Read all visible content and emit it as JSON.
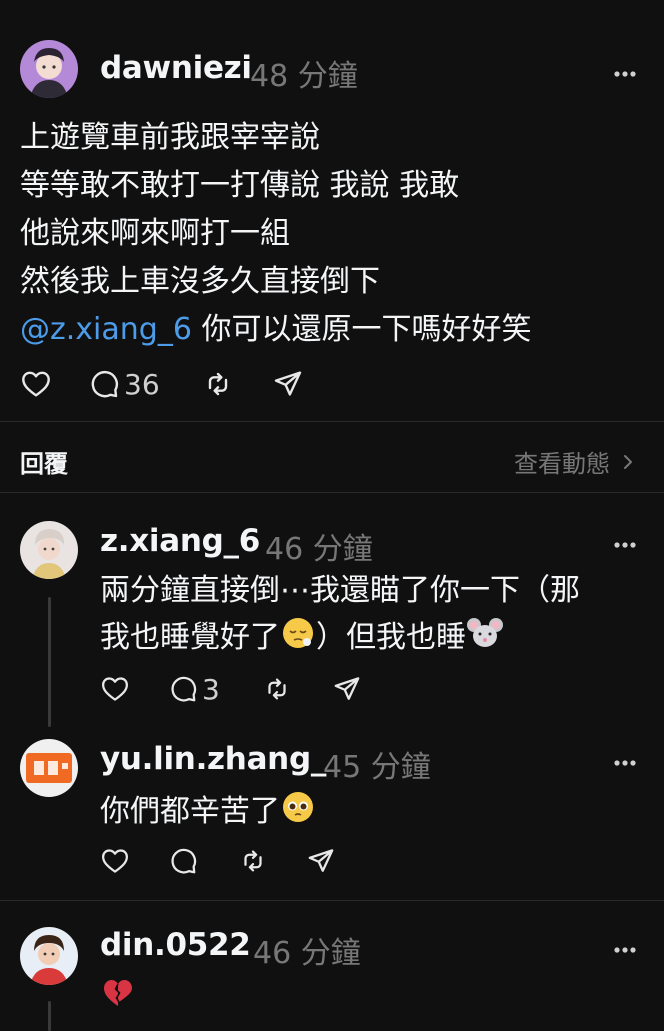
{
  "main_post": {
    "username": "dawniezi",
    "time": "48 分鐘",
    "lines": [
      "上遊覽車前我跟宰宰說",
      "等等敢不敢打一打傳說 我說 我敢",
      "他說來啊來啊打一組",
      "然後我上車沒多久直接倒下"
    ],
    "mention": "@z.xiang_6",
    "last_line_rest": " 你可以還原一下嗎好好笑",
    "reply_count": "36"
  },
  "replies_section": {
    "label": "回覆",
    "view_activity": "查看動態"
  },
  "replies": [
    {
      "username": "z.xiang_6",
      "time": "46 分鐘",
      "line1": "兩分鐘直接倒⋯我還瞄了你一下（那",
      "line2_before": "我也睡覺好了",
      "line2_mid": "）但我也睡",
      "reply_count": "3"
    },
    {
      "username": "yu.lin.zhang_",
      "time": "45 分鐘",
      "line1": "你們都辛苦了"
    },
    {
      "username": "din.0522",
      "time": "46 分鐘"
    }
  ],
  "colors": {
    "background": "#101010",
    "text": "#f3f5f7",
    "secondary": "#777777",
    "mention": "#4c9ce9",
    "divider": "#2a2a2a"
  },
  "icons": [
    "heart-icon",
    "comment-icon",
    "repost-icon",
    "share-icon",
    "more-icon",
    "chevron-right-icon"
  ]
}
